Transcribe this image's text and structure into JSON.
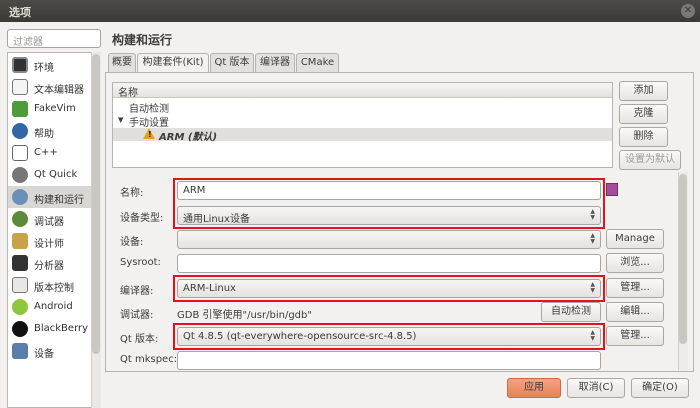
{
  "window": {
    "title": "选项"
  },
  "sidebar": {
    "filter_placeholder": "过滤器",
    "items": [
      {
        "label": "环境",
        "icon": "monitor-icon"
      },
      {
        "label": "文本编辑器",
        "icon": "text-editor-icon"
      },
      {
        "label": "FakeVim",
        "icon": "fakevim-icon"
      },
      {
        "label": "帮助",
        "icon": "help-icon"
      },
      {
        "label": "C++",
        "icon": "cpp-braces-icon"
      },
      {
        "label": "Qt Quick",
        "icon": "qt-quick-icon"
      },
      {
        "label": "构建和运行",
        "icon": "build-run-icon"
      },
      {
        "label": "调试器",
        "icon": "debugger-icon"
      },
      {
        "label": "设计师",
        "icon": "designer-icon"
      },
      {
        "label": "分析器",
        "icon": "analyzer-icon"
      },
      {
        "label": "版本控制",
        "icon": "version-control-icon"
      },
      {
        "label": "Android",
        "icon": "android-icon"
      },
      {
        "label": "BlackBerry",
        "icon": "blackberry-icon"
      },
      {
        "label": "设备",
        "icon": "devices-icon"
      }
    ]
  },
  "page_title": "构建和运行",
  "tabs": [
    {
      "label": "概要"
    },
    {
      "label": "构建套件(Kit)"
    },
    {
      "label": "Qt 版本"
    },
    {
      "label": "编译器"
    },
    {
      "label": "CMake"
    }
  ],
  "kits": {
    "column_header": "名称",
    "auto_detect": "自动检测",
    "manual": "手动设置",
    "manual_expander": "▼",
    "selected_kit": "ARM (默认)"
  },
  "kit_buttons": {
    "add": "添加",
    "clone": "克隆",
    "delete": "删除",
    "set_default": "设置为默认"
  },
  "form": {
    "name_label": "名称:",
    "name_value": "ARM",
    "device_type_label": "设备类型:",
    "device_type_value": "通用Linux设备",
    "device_label": "设备:",
    "device_value": "",
    "manage_device": "Manage",
    "sysroot_label": "Sysroot:",
    "sysroot_value": "",
    "browse": "浏览...",
    "compiler_label": "编译器:",
    "compiler_value": "ARM-Linux",
    "compiler_manage": "管理...",
    "debugger_label": "调试器:",
    "debugger_value": "GDB 引擎使用\"/usr/bin/gdb\"",
    "auto_detect_btn": "自动检测",
    "edit_btn": "编辑...",
    "qt_version_label": "Qt 版本:",
    "qt_version_value": "Qt 4.8.5 (qt-everywhere-opensource-src-4.8.5)",
    "qt_manage": "管理...",
    "qt_mkspec_label": "Qt mkspec:",
    "qt_mkspec_value": ""
  },
  "dialog_buttons": {
    "apply": "应用",
    "cancel": "取消(C)",
    "ok": "确定(O)"
  },
  "colors": {
    "highlight_box": "#e0141c",
    "apply_button": "#e8825a",
    "title_bar": "#3a3935"
  }
}
